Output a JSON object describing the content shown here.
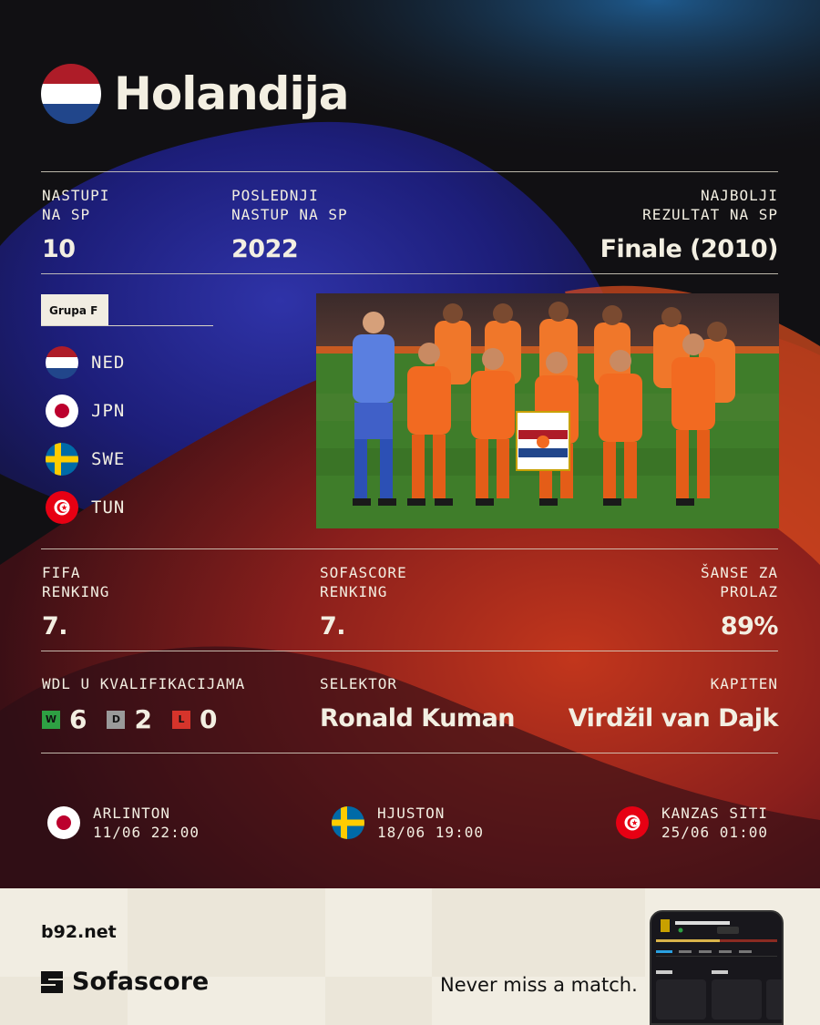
{
  "team": {
    "name": "Holandija"
  },
  "stats_top": [
    {
      "label_line1": "NASTUPI",
      "label_line2": "NA SP",
      "value": "10"
    },
    {
      "label_line1": "POSLEDNJI",
      "label_line2": "NASTUP NA SP",
      "value": "2022"
    },
    {
      "label_line1": "NAJBOLJI",
      "label_line2": "REZULTAT NA SP",
      "value": "Finale (2010)"
    }
  ],
  "group": {
    "label": "Grupa F",
    "teams": [
      {
        "code": "NED",
        "flag": "netherlands-flag"
      },
      {
        "code": "JPN",
        "flag": "japan-flag"
      },
      {
        "code": "SWE",
        "flag": "sweden-flag"
      },
      {
        "code": "TUN",
        "flag": "tunisia-flag"
      }
    ]
  },
  "ranking": [
    {
      "label_line1": "FIFA",
      "label_line2": "RENKING",
      "value": "7."
    },
    {
      "label_line1": "SOFASCORE",
      "label_line2": "RENKING",
      "value": "7."
    },
    {
      "label_line1": "ŠANSE ZA",
      "label_line2": "PROLAZ",
      "value": "89%"
    }
  ],
  "qualifying": {
    "label": "WDL U KVALIFIKACIJAMA",
    "w_badge": "W",
    "w": "6",
    "d_badge": "D",
    "d": "2",
    "l_badge": "L",
    "l": "0"
  },
  "coach": {
    "label": "SELEKTOR",
    "value": "Ronald Kuman"
  },
  "captain": {
    "label": "KAPITEN",
    "value": "Virdžil van Dajk"
  },
  "matches": [
    {
      "opponent_flag": "japan-flag",
      "city": "ARLINTON",
      "datetime": "11/06 22:00"
    },
    {
      "opponent_flag": "sweden-flag",
      "city": "HJUSTON",
      "datetime": "18/06 19:00"
    },
    {
      "opponent_flag": "tunisia-flag",
      "city": "KANZAS SITI",
      "datetime": "25/06 01:00"
    }
  ],
  "footer": {
    "b92": "b92.net",
    "sofascore": "Sofascore",
    "tagline": "Never miss a match."
  },
  "colors": {
    "background": "#111013",
    "text": "#f3efe2",
    "win": "#2ea043",
    "draw": "#9a9a9a",
    "loss": "#d6342b",
    "footer": "#f1ede2",
    "oranje": "#f26a21"
  }
}
